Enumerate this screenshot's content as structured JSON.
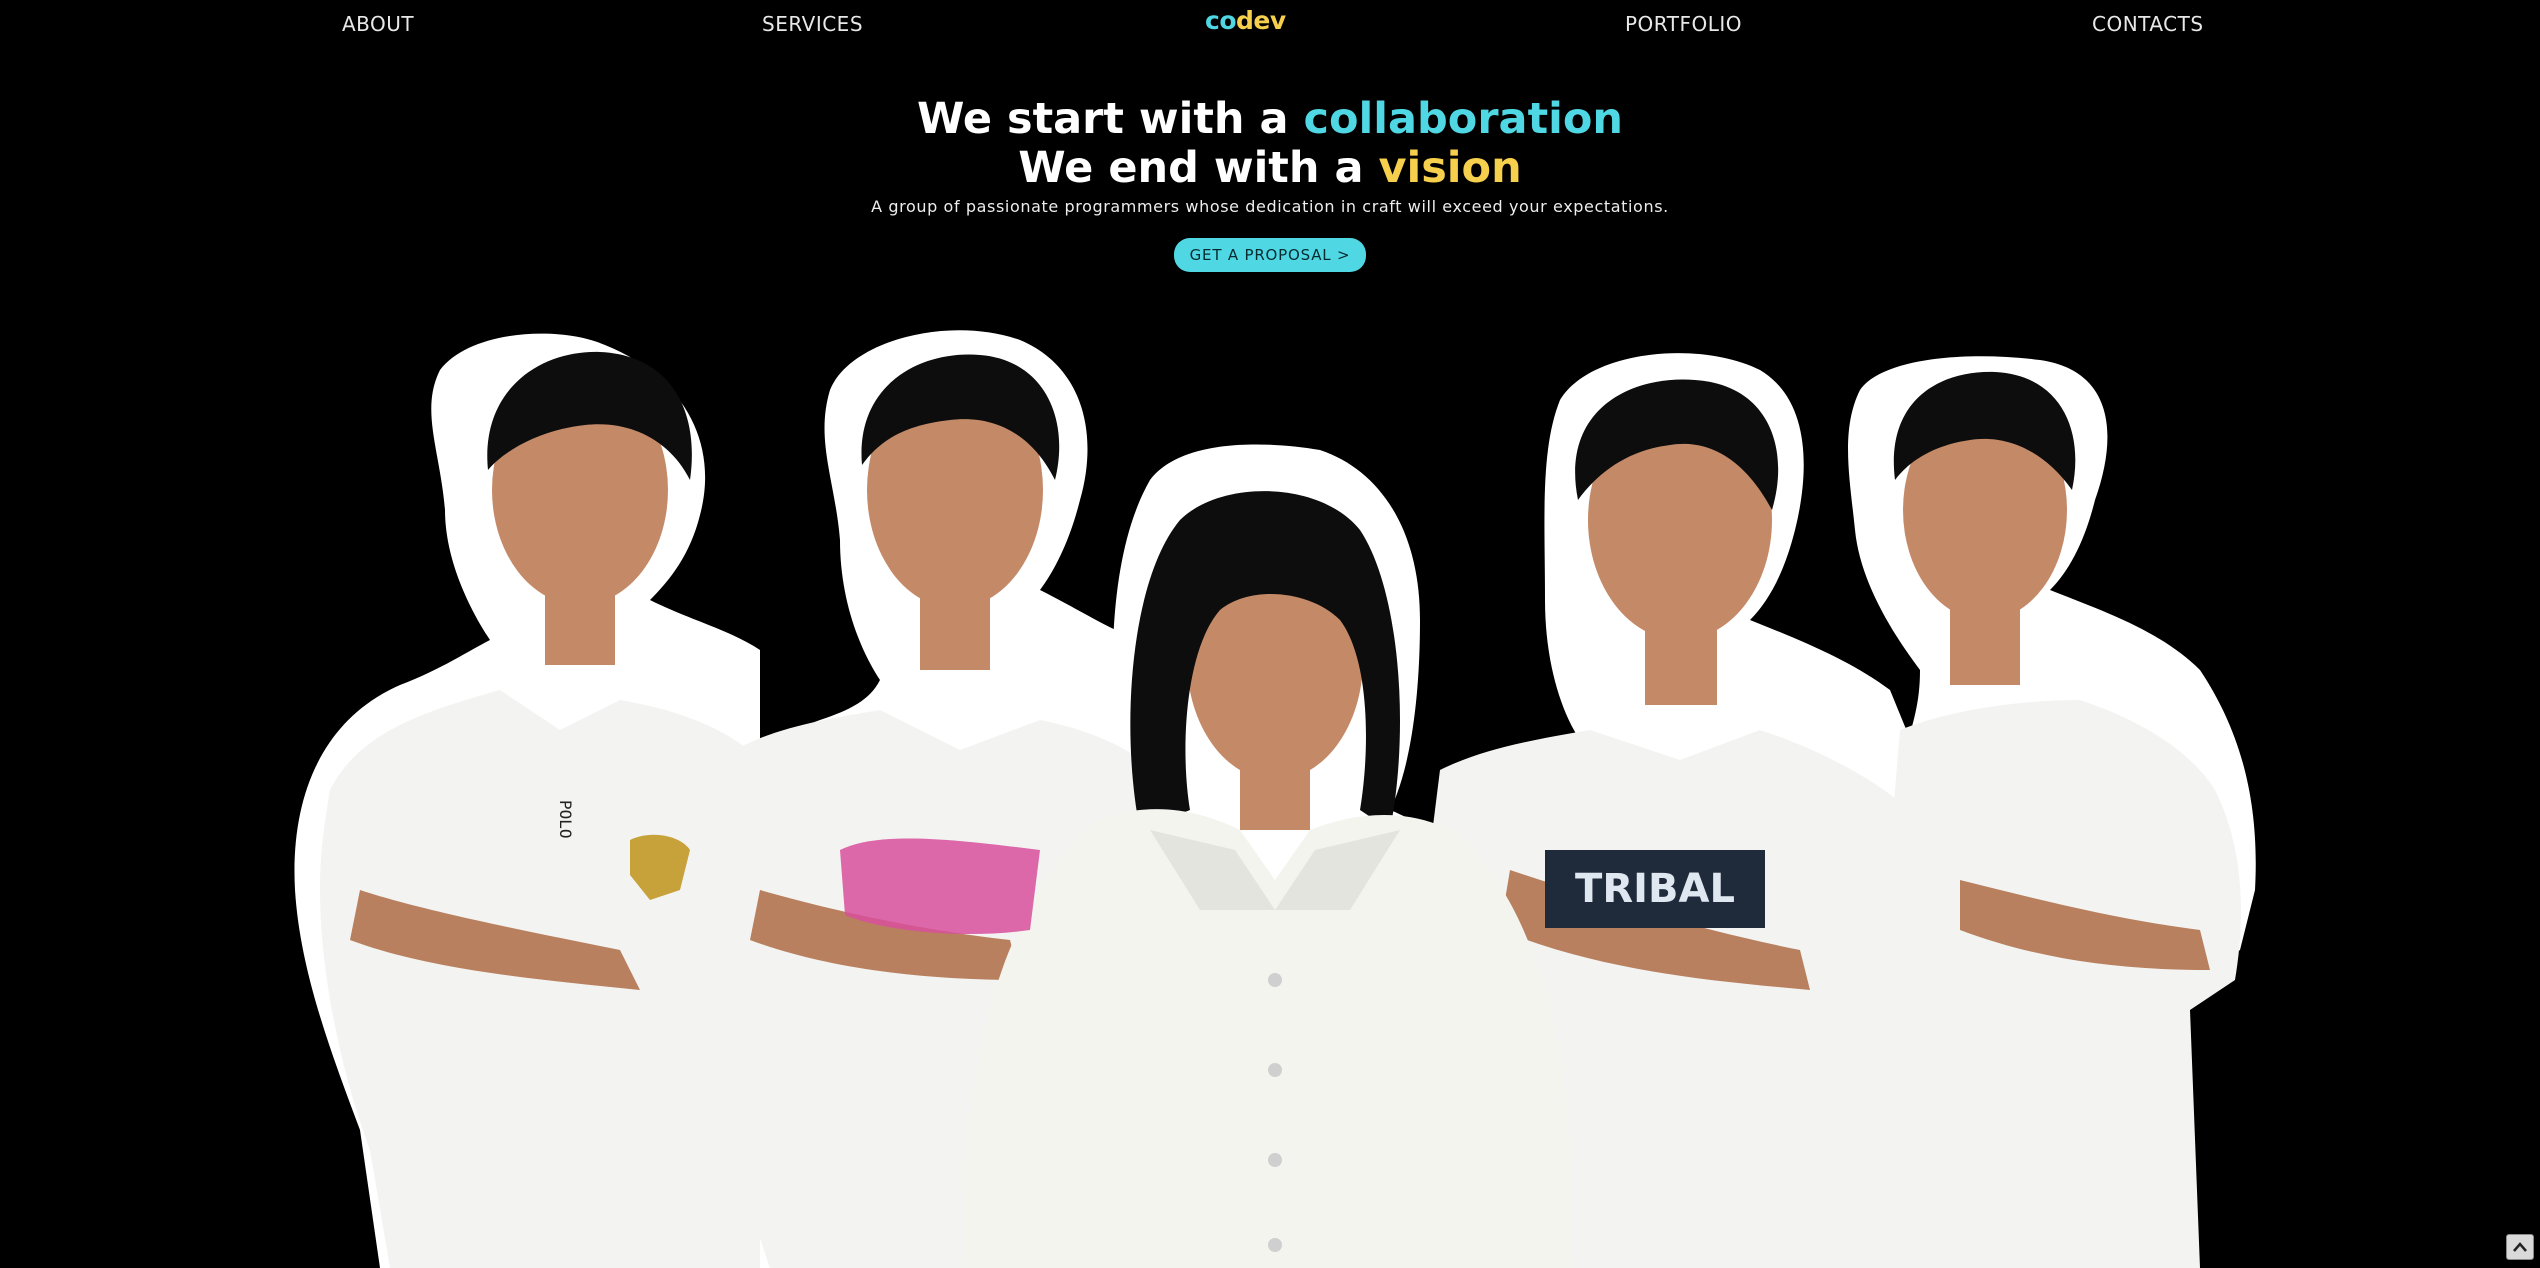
{
  "nav": {
    "about": "ABOUT",
    "services": "SERVICES",
    "portfolio": "PORTFOLIO",
    "contacts": "CONTACTS"
  },
  "logo": {
    "part1": "co",
    "part2": "dev"
  },
  "hero": {
    "line1_prefix": "We start with a ",
    "line1_accent": "collaboration",
    "line2_prefix": "We end with a ",
    "line2_accent": "vision",
    "subtitle": "A group of passionate programmers whose dedication in craft will exceed your expectations.",
    "cta_label": "GET A PROPOSAL >"
  },
  "team_photo": {
    "shirt_prints": [
      "POLO",
      "TRIBAL"
    ]
  },
  "colors": {
    "background": "#000000",
    "accent_cyan": "#4fd8e4",
    "accent_yellow": "#f6d04d",
    "text": "#ffffff"
  },
  "icons": {
    "scroll_top": "chevron-up-icon"
  }
}
